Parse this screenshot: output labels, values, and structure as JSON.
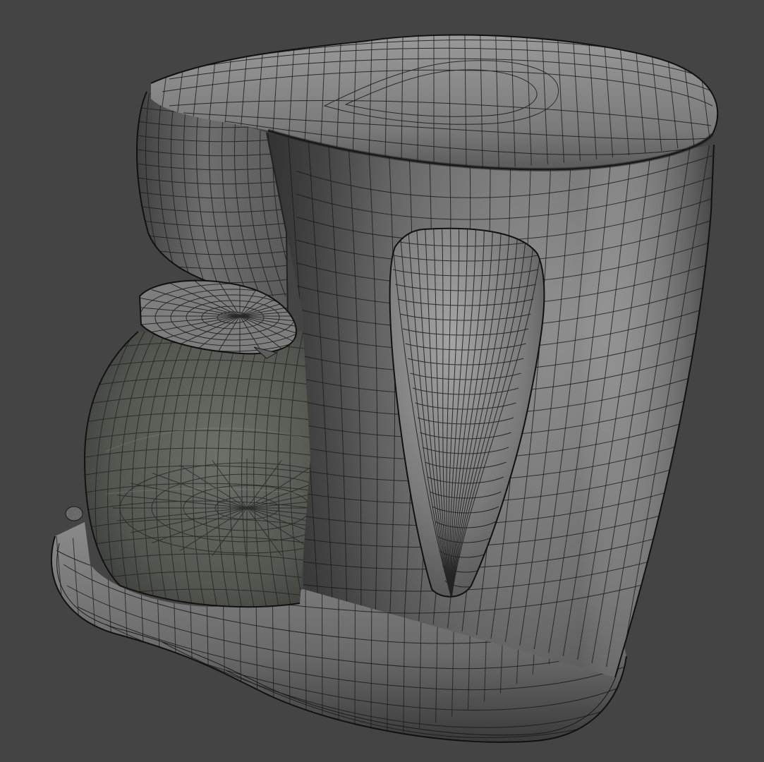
{
  "viewport": {
    "background_color": "#444444",
    "display_mode": "shaded-with-wireframe"
  },
  "model": {
    "subject": "coffee maker",
    "shading_color": "#7b7b7b",
    "wire_color": "#1a1a1a",
    "parts": [
      "lid",
      "reservoir-body",
      "filter-head",
      "side-handle",
      "base-plate",
      "glass-carafe",
      "carafe-lid"
    ]
  }
}
